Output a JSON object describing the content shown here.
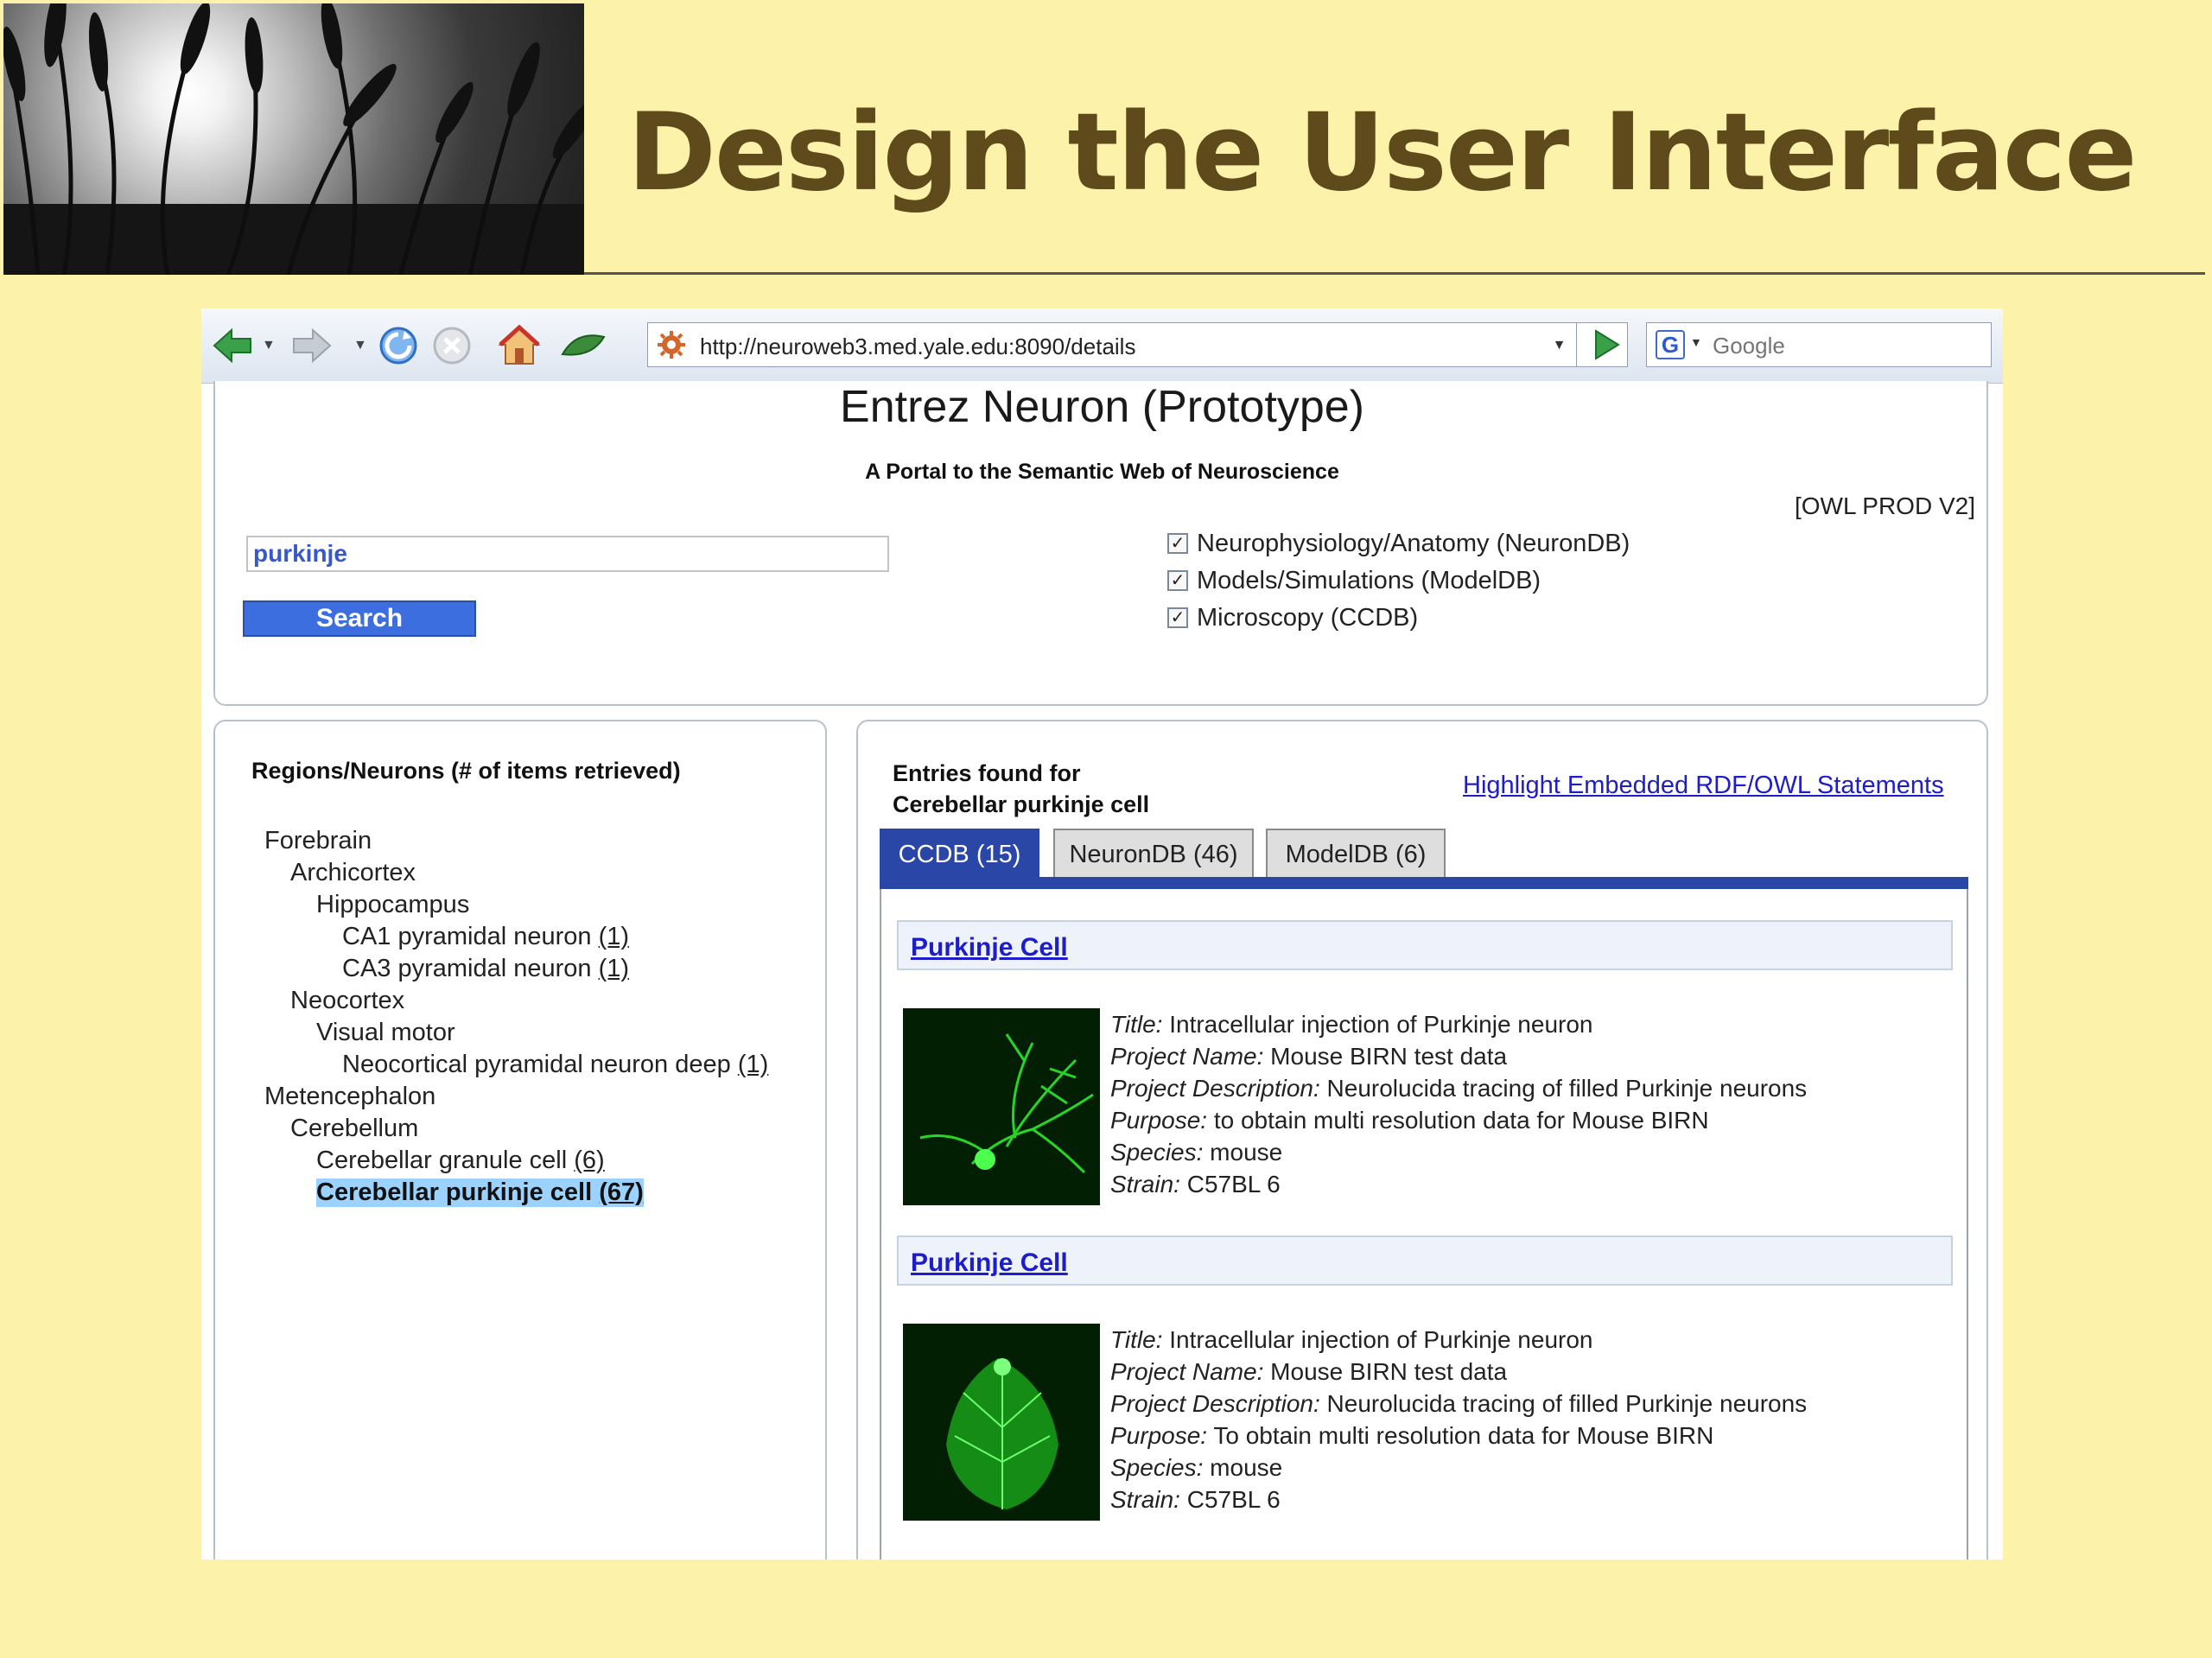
{
  "slide": {
    "title": "Design the User Interface"
  },
  "browser": {
    "url": "http://neuroweb3.med.yale.edu:8090/details",
    "search_placeholder": "Google"
  },
  "app": {
    "title": "Entrez Neuron (Prototype)",
    "subtitle": "A Portal to the Semantic Web of Neuroscience",
    "version": "[OWL PROD V2]",
    "search_value": "purkinje",
    "search_button": "Search",
    "sources": [
      {
        "label": "Neurophysiology/Anatomy (NeuronDB)",
        "checked": true
      },
      {
        "label": "Models/Simulations (ModelDB)",
        "checked": true
      },
      {
        "label": "Microscopy (CCDB)",
        "checked": true
      }
    ]
  },
  "regions": {
    "heading": "Regions/Neurons (# of items retrieved)",
    "tree": [
      {
        "label": "Forebrain",
        "count": ""
      },
      {
        "label": "Archicortex",
        "count": ""
      },
      {
        "label": "Hippocampus",
        "count": ""
      },
      {
        "label": "CA1 pyramidal neuron ",
        "count": "(1)"
      },
      {
        "label": "CA3 pyramidal neuron ",
        "count": "(1)"
      },
      {
        "label": "Neocortex",
        "count": ""
      },
      {
        "label": "Visual motor",
        "count": ""
      },
      {
        "label": "Neocortical pyramidal neuron deep ",
        "count": "(1)"
      },
      {
        "label": "Metencephalon",
        "count": ""
      },
      {
        "label": "Cerebellum",
        "count": ""
      },
      {
        "label": "Cerebellar granule cell ",
        "count": "(6)"
      },
      {
        "label": "Cerebellar purkinje cell ",
        "count": "(67)"
      }
    ]
  },
  "entries": {
    "heading_line1": "Entries found for",
    "heading_line2": "Cerebellar purkinje cell",
    "highlight_link": "Highlight Embedded RDF/OWL Statements",
    "tabs": [
      {
        "label": "CCDB (15)",
        "active": true
      },
      {
        "label": "NeuronDB (46)",
        "active": false
      },
      {
        "label": "ModelDB (6)",
        "active": false
      }
    ],
    "results": [
      {
        "name": "Purkinje Cell",
        "title_label": "Title:",
        "title": " Intracellular injection of Purkinje neuron",
        "project_name_label": "Project Name:",
        "project_name": " Mouse BIRN test data",
        "project_description_label": "Project Description:",
        "project_description": " Neurolucida tracing of filled Purkinje neurons",
        "purpose_label": "Purpose:",
        "purpose": " to obtain multi resolution data for Mouse BIRN",
        "species_label": "Species:",
        "species": " mouse",
        "strain_label": "Strain:",
        "strain": " C57BL 6"
      },
      {
        "name": "Purkinje Cell",
        "title_label": "Title:",
        "title": " Intracellular injection of Purkinje neuron",
        "project_name_label": "Project Name:",
        "project_name": " Mouse BIRN test data",
        "project_description_label": "Project Description:",
        "project_description": " Neurolucida tracing of filled Purkinje neurons",
        "purpose_label": "Purpose:",
        "purpose": " To obtain multi resolution data for Mouse BIRN",
        "species_label": "Species:",
        "species": " mouse",
        "strain_label": "Strain:",
        "strain": " C57BL 6"
      }
    ]
  },
  "colors": {
    "slide_background": "#fdf2a9",
    "title_color": "#5e4a1b",
    "tab_active": "#2a46a6",
    "link": "#1d1dc9",
    "selected_highlight": "#9cd2ff"
  },
  "icons": [
    "back-arrow-icon",
    "forward-arrow-icon",
    "reload-icon",
    "stop-icon",
    "home-icon",
    "leaf-icon",
    "site-icon",
    "go-arrow-icon",
    "google-icon"
  ]
}
